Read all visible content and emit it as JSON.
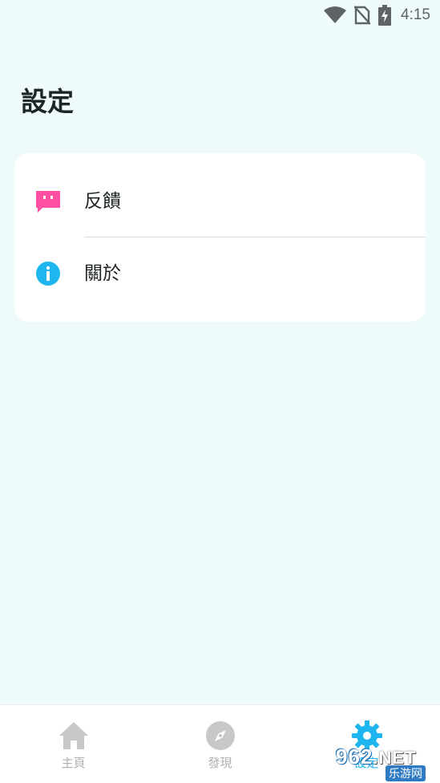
{
  "status_bar": {
    "time": "4:15",
    "icons": [
      "wifi-icon",
      "no-sim-icon",
      "battery-charging-icon"
    ]
  },
  "page": {
    "title": "設定"
  },
  "settings_list": {
    "items": [
      {
        "label": "反饋",
        "icon": "feedback-icon",
        "icon_color": "#ff4fa0"
      },
      {
        "label": "關於",
        "icon": "info-icon",
        "icon_color": "#1fb5ee"
      }
    ]
  },
  "bottom_nav": {
    "items": [
      {
        "label": "主頁",
        "icon": "home-icon",
        "active": false
      },
      {
        "label": "發現",
        "icon": "compass-icon",
        "active": false
      },
      {
        "label": "設定",
        "icon": "gear-icon",
        "active": true
      }
    ],
    "inactive_color": "#c8c8c8",
    "active_color": "#1fb5ee"
  },
  "watermark": {
    "top_text": "962",
    "top_suffix": ".NET",
    "bottom_text": "乐游网"
  }
}
